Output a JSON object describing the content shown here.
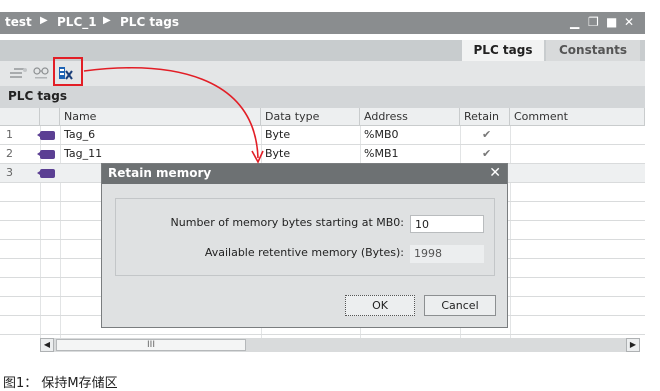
{
  "breadcrumb": {
    "project": "test",
    "device": "PLC_1",
    "section": "PLC tags"
  },
  "tabs": [
    {
      "label": "PLC tags"
    },
    {
      "label": "Constants"
    }
  ],
  "section_title": "PLC tags",
  "table": {
    "columns": [
      "Name",
      "Data type",
      "Address",
      "Retain",
      "Comment"
    ],
    "rows": [
      {
        "num": "1",
        "name": "Tag_6",
        "type": "Byte",
        "address": "%MB0",
        "retain": "✔"
      },
      {
        "num": "2",
        "name": "Tag_11",
        "type": "Byte",
        "address": "%MB1",
        "retain": "✔"
      },
      {
        "num": "3"
      }
    ]
  },
  "scrollbar": {
    "thumb_label": "III"
  },
  "dialog": {
    "title": "Retain memory",
    "bytes_label": "Number of memory bytes starting at MB0:",
    "bytes_value": "10",
    "available_label": "Available retentive memory (Bytes):",
    "available_value": "1998",
    "ok_label": "OK",
    "cancel_label": "Cancel"
  },
  "caption": "图1：  保持M存储区",
  "colors": {
    "titlebar": "#8a8d8f",
    "dialog_title": "#6d7173",
    "highlight": "#e21e26",
    "tag_icon": "#5b3f93"
  }
}
